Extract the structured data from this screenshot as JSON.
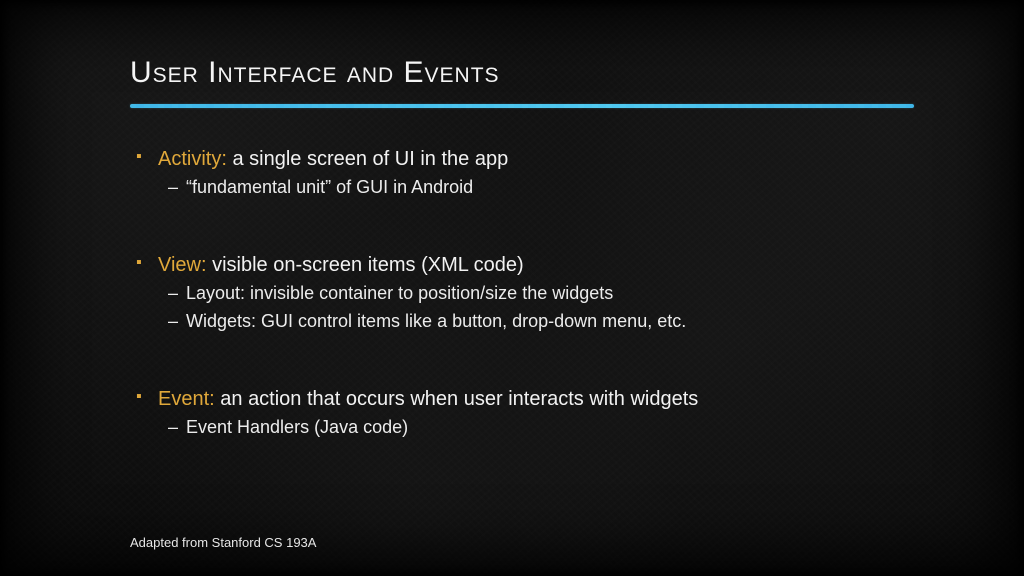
{
  "title": "User Interface and Events",
  "items": [
    {
      "term": "Activity:",
      "desc": " a single screen of UI in the app",
      "subs": [
        "“fundamental unit” of GUI in Android"
      ]
    },
    {
      "term": "View:",
      "desc": " visible on-screen items (XML code)",
      "subs": [
        "Layout: invisible container to position/size the widgets",
        "Widgets: GUI control items like a button, drop-down menu, etc."
      ]
    },
    {
      "term": "Event:",
      "desc": " an action that occurs when user interacts with widgets",
      "subs": [
        "Event Handlers (Java code)"
      ]
    }
  ],
  "footer": "Adapted from Stanford CS 193A"
}
